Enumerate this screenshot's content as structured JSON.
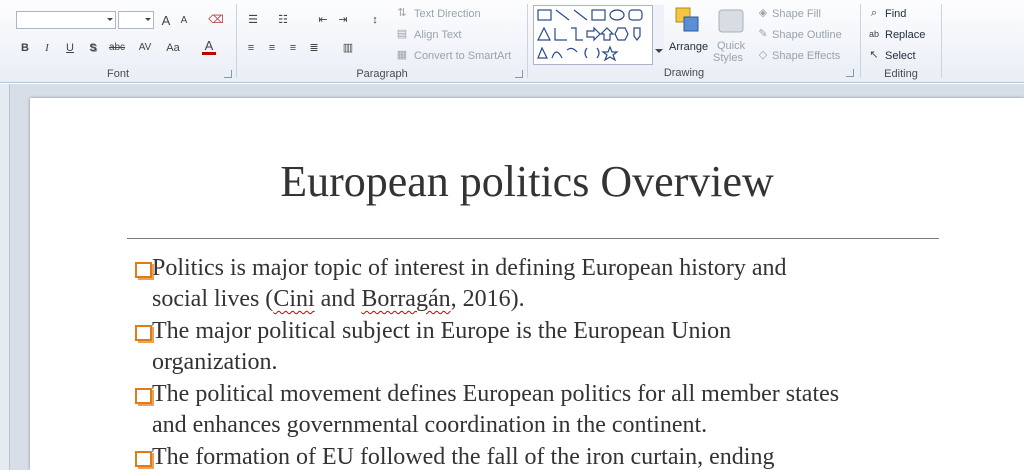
{
  "ribbon": {
    "groups": {
      "font": {
        "label": "Font"
      },
      "paragraph": {
        "label": "Paragraph"
      },
      "drawing": {
        "label": "Drawing"
      },
      "editing": {
        "label": "Editing"
      }
    },
    "paragraph": {
      "text_direction": "Text Direction",
      "align_text": "Align Text",
      "convert_smartart": "Convert to SmartArt"
    },
    "drawing": {
      "arrange": "Arrange",
      "quick_styles_line1": "Quick",
      "quick_styles_line2": "Styles",
      "shape_fill": "Shape Fill",
      "shape_outline": "Shape Outline",
      "shape_effects": "Shape Effects"
    },
    "editing": {
      "find": "Find",
      "replace": "Replace",
      "select": "Select"
    },
    "font_buttons": {
      "bold": "B",
      "italic": "I",
      "underline": "U",
      "shadow": "S",
      "strike": "abc",
      "spacing": "AV",
      "case": "Aa",
      "color": "A",
      "grow": "A",
      "shrink": "A"
    }
  },
  "slide": {
    "title": "European politics Overview",
    "bullets": [
      {
        "line1": "Politics is major topic of interest in defining European history and",
        "line2_pre": "social lives (",
        "line2_cite1": "Cini",
        "line2_mid": " and ",
        "line2_cite2": "Borragán",
        "line2_post": ", 2016)."
      },
      {
        "line1": "The major political subject in Europe is the European Union",
        "line2": "organization."
      },
      {
        "line1": "The political movement  defines European politics for all member  states",
        "line2": "and enhances governmental  coordination in the continent."
      },
      {
        "line1": "The  formation  of EU followed the fall of the iron curtain, ending",
        "line2": ""
      }
    ]
  },
  "colors": {
    "bullet_orange": "#e07c18",
    "ribbon_bg": "#e9eef5",
    "workspace": "#d7dee8"
  }
}
